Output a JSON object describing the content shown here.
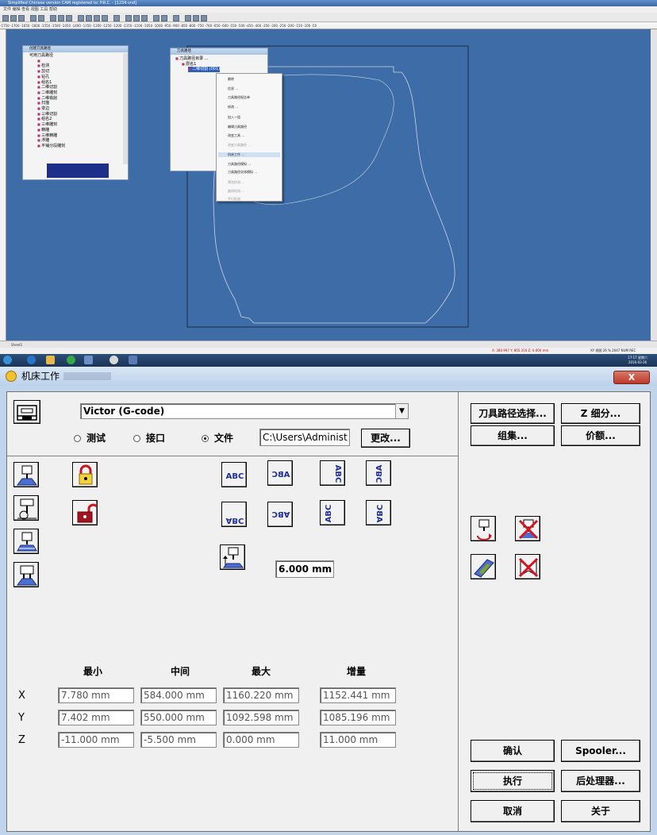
{
  "app": {
    "title": "Simplified Chinese  version  CAM registered to: P.R.C. - [1234.vnd]",
    "menu": "文件  编辑  查看  视图  工具  帮助",
    "ruler": "-1750  -1700  -1650  -1600  -1550  -1500  -1450  -1400  -1350  -1300  -1250  -1200  -1150  -1100  -1050  -1000  -950  -900  -850  -800  -750  -700  -650  -600  -550  -500  -450  -400  -350  -300  -250  -200  -150  -100  -50",
    "sheet_tab": "Sheet1",
    "status_coords": "X: 380.997   Y: 865.316   Z: 0.000 mm",
    "status_right": "XY 视图   26 % 2047  NUM  REC",
    "clock_time": "17:17 星期六",
    "clock_date": "2016-03-26"
  },
  "panel_tools": {
    "title": "创建刀具路径",
    "root": "可用刀具路径",
    "items": [
      "检测",
      "剪切",
      "钻孔",
      "组名1",
      "二维切割",
      "二维雕刻",
      "二维铣削",
      "扫描",
      "变边",
      "三维切割",
      "组名2",
      "三维雕刻",
      "精雕",
      "三维精雕",
      "浮雕",
      "平铺分段雕刻"
    ]
  },
  "panel_list": {
    "title": "刀具路径",
    "root": "刀具路径目录 ...",
    "layer": "层名1",
    "selected": "二维切割 (001)"
  },
  "context_menu": {
    "items": [
      "删除",
      "信息 ...",
      "刀具路径报告单",
      "修改 ...",
      "加入一组",
      "编辑刀具路径",
      "改变工具 ...",
      "改变刀具路径 ...",
      "机床工作 ...",
      "刀具路径模拟 ...",
      "刀具路径实体模拟 ...",
      "预览检测 ...",
      "路线检测 ...",
      "平行检测"
    ]
  },
  "dialog": {
    "title": "机床工作",
    "close": "X",
    "machine": "Victor (G-code)",
    "radio_test": "测试",
    "radio_port": "接口",
    "radio_file": "文件",
    "file_path": "C:\\Users\\Administ",
    "change_btn": "更改...",
    "abc_texts": [
      "ABC",
      "ABC",
      "ABC",
      "ABC",
      "ABC",
      "ABC",
      "ABC",
      "ABC"
    ],
    "safe_z": "6.000 mm",
    "headers": {
      "min": "最小",
      "mid": "中间",
      "max": "最大",
      "inc": "增量"
    },
    "rows": [
      {
        "axis": "X",
        "min": "7.780 mm",
        "mid": "584.000 mm",
        "max": "1160.220 mm",
        "inc": "1152.441 mm"
      },
      {
        "axis": "Y",
        "min": "7.402 mm",
        "mid": "550.000 mm",
        "max": "1092.598 mm",
        "inc": "1085.196 mm"
      },
      {
        "axis": "Z",
        "min": "-11.000 mm",
        "mid": "-5.500 mm",
        "max": "0.000 mm",
        "inc": "11.000 mm"
      }
    ],
    "buttons": {
      "toolpath_select": "刀具路径选择...",
      "z_detail": "Z 细分...",
      "group": "组集...",
      "price": "价额...",
      "confirm": "确认",
      "spooler": "Spooler...",
      "execute": "执行",
      "postprocessor": "后处理器...",
      "cancel": "取消",
      "about": "关于"
    }
  },
  "colors": {
    "canvas": "#3d6ca6",
    "abc_text": "#1f2e9a",
    "lock_red": "#c8141e",
    "close_red": "#c0392b"
  }
}
